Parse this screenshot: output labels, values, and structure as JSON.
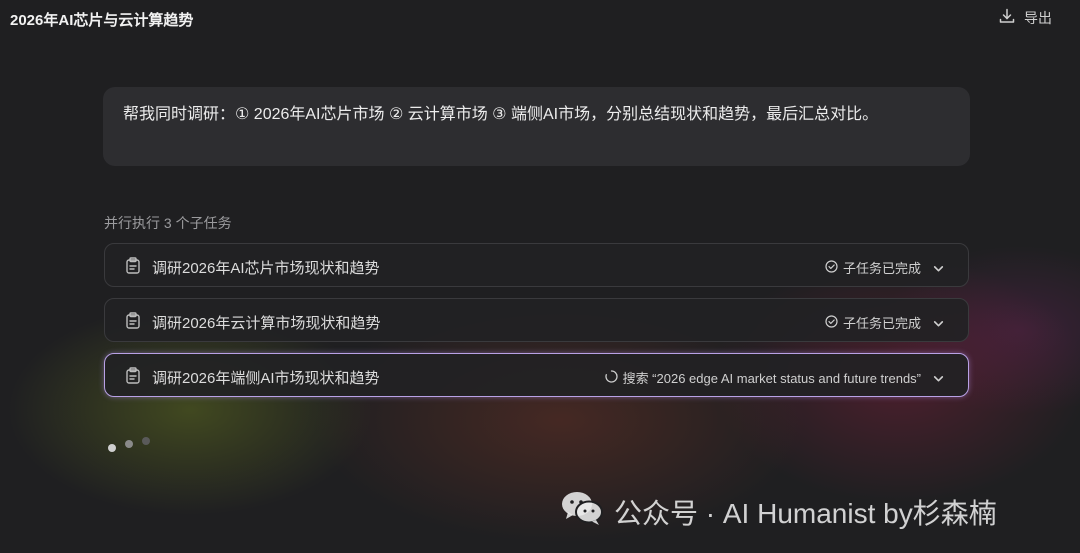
{
  "header": {
    "title": "2026年AI芯片与云计算趋势",
    "export_label": "导出"
  },
  "prompt": {
    "text": "帮我同时调研：① 2026年AI芯片市场 ② 云计算市场 ③ 端侧AI市场，分别总结现状和趋势，最后汇总对比。"
  },
  "subtasks": {
    "section_label": "并行执行 3 个子任务",
    "items": [
      {
        "label": "调研2026年AI芯片市场现状和趋势",
        "status": "子任务已完成"
      },
      {
        "label": "调研2026年云计算市场现状和趋势",
        "status": "子任务已完成"
      },
      {
        "label": "调研2026年端侧AI市场现状和趋势",
        "status": "搜索 “2026 edge AI market status and future trends”"
      }
    ]
  },
  "watermark": {
    "text": "公众号 · AI Humanist by杉森楠"
  },
  "colors": {
    "background": "#1f1f21",
    "prompt_bg": "#2d2d30",
    "active_border": "#b9a1e6"
  }
}
